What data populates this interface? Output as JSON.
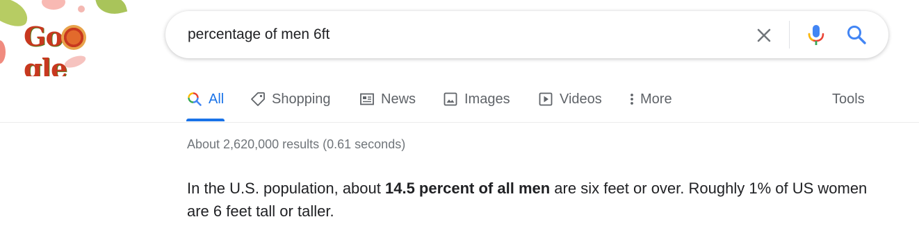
{
  "header": {
    "logo_alt": "Google",
    "search": {
      "query": "percentage of men 6ft",
      "placeholder": ""
    },
    "icons": {
      "clear": "close-icon",
      "voice": "microphone-icon",
      "search": "search-icon"
    }
  },
  "tabs": [
    {
      "label": "All",
      "icon": "search-multicolor-icon",
      "active": true
    },
    {
      "label": "Shopping",
      "icon": "tag-icon",
      "active": false
    },
    {
      "label": "News",
      "icon": "newspaper-icon",
      "active": false
    },
    {
      "label": "Images",
      "icon": "image-icon",
      "active": false
    },
    {
      "label": "Videos",
      "icon": "play-icon",
      "active": false
    },
    {
      "label": "More",
      "icon": "vertical-dots-icon",
      "active": false
    }
  ],
  "tools_label": "Tools",
  "results": {
    "stats": "About 2,620,000 results (0.61 seconds)",
    "snippet": {
      "before": "In the U.S. population, about ",
      "bold": "14.5 percent of all men",
      "after": " are six feet or over. Roughly 1% of US women are 6 feet tall or taller."
    }
  },
  "colors": {
    "accent": "#1a73e8",
    "text": "#202124",
    "muted": "#5f6368",
    "stats": "#70757a"
  }
}
